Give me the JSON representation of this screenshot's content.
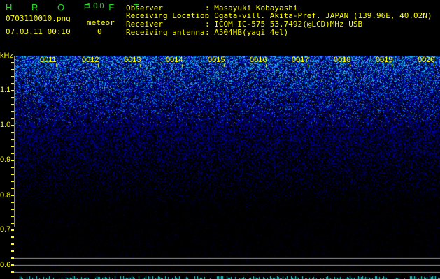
{
  "app": {
    "name": "H R O F F T",
    "version": "1.0.0"
  },
  "file": {
    "name": "0703110010.png",
    "datetime": "07.03.11 00:10"
  },
  "meteor": {
    "label": "meteor",
    "count": "0"
  },
  "info": [
    {
      "label": "Observer",
      "value": ": Masayuki Kobayashi"
    },
    {
      "label": "Receiving Location",
      "value": ": Ogata-vill. Akita-Pref. JAPAN (139.96E, 40.02N)"
    },
    {
      "label": "Receiver",
      "value": ": ICOM IC-575 53.7492(@LCD)MHz USB"
    },
    {
      "label": "Receiving antenna",
      "value": ": A504HB(yagi 4el)"
    }
  ],
  "axis": {
    "unit": "kHz",
    "y_labels": [
      "1.1",
      "1.0",
      "0.9",
      "0.8",
      "0.7",
      "0.6"
    ],
    "time_labels": [
      "0011",
      "0012",
      "0013",
      "0014",
      "0015",
      "0016",
      "0017",
      "0018",
      "0019",
      "0020"
    ]
  },
  "colors": {
    "text": "#ffff00",
    "logo": "#22dd22",
    "signal": "#1030ff",
    "meteor_bar": "#30e0e0"
  }
}
